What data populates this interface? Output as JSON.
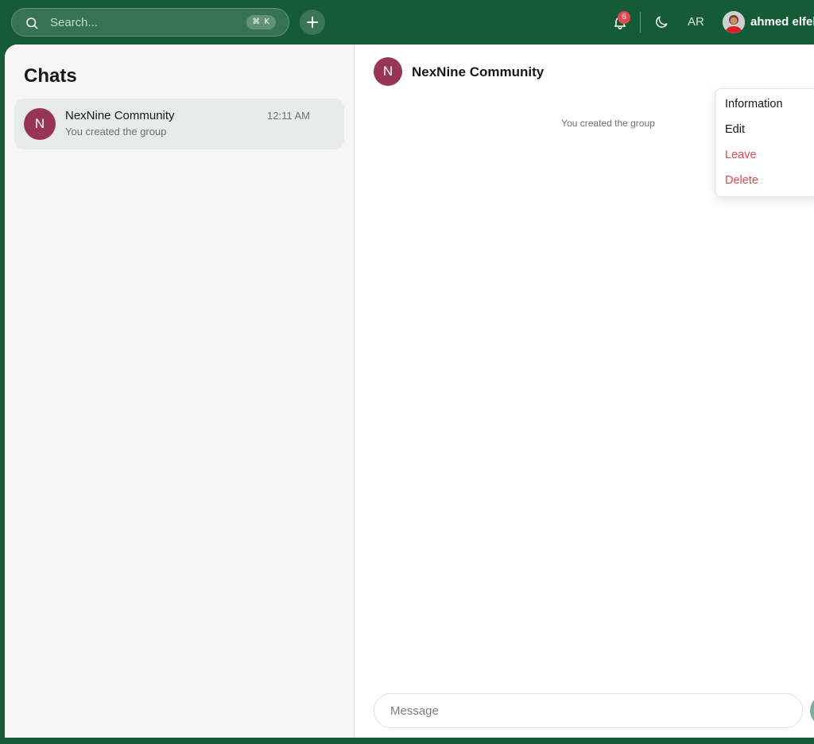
{
  "topbar": {
    "search_placeholder": "Search...",
    "search_shortcut": "⌘ K",
    "notifications_count": "6",
    "language_label": "AR",
    "user_name": "ahmed elfek"
  },
  "sidebar": {
    "title": "Chats",
    "chats": [
      {
        "avatar_letter": "N",
        "name": "NexNine Community",
        "time": "12:11 AM",
        "preview": "You created the group"
      }
    ]
  },
  "conversation": {
    "avatar_letter": "N",
    "title": "NexNine Community",
    "system_message": "You created the group",
    "message_placeholder": "Message"
  },
  "menu": {
    "items": [
      {
        "label": "Information",
        "color": "#16181a"
      },
      {
        "label": "Edit",
        "color": "#16181a"
      },
      {
        "label": "Leave",
        "color": "#e5484d"
      },
      {
        "label": "Delete",
        "color": "#e5484d"
      }
    ]
  },
  "colors": {
    "brand_green": "#165b38",
    "avatar_color": "#963555",
    "danger": "#e5484d"
  }
}
